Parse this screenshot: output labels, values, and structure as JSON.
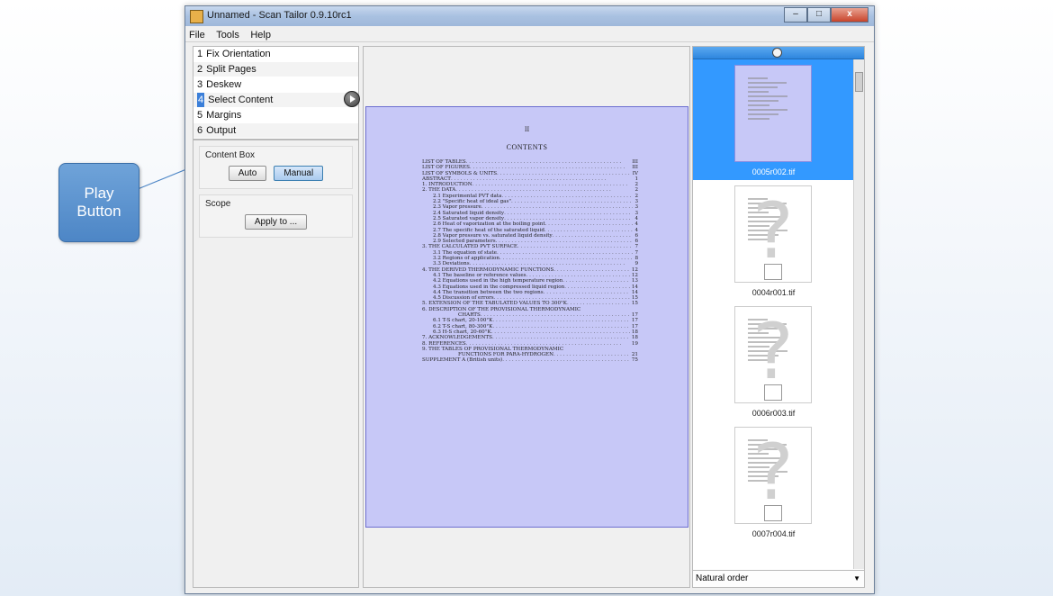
{
  "window": {
    "title": "Unnamed - Scan Tailor 0.9.10rc1",
    "controls": {
      "minimize": "–",
      "maximize": "□",
      "close": "x"
    }
  },
  "menu": [
    "File",
    "Tools",
    "Help"
  ],
  "stages": [
    {
      "num": "1",
      "label": "Fix Orientation"
    },
    {
      "num": "2",
      "label": "Split Pages"
    },
    {
      "num": "3",
      "label": "Deskew"
    },
    {
      "num": "4",
      "label": "Select Content",
      "selected": true
    },
    {
      "num": "5",
      "label": "Margins"
    },
    {
      "num": "6",
      "label": "Output"
    }
  ],
  "options": {
    "content_box": {
      "title": "Content Box",
      "auto": "Auto",
      "manual": "Manual",
      "active": "Manual"
    },
    "scope": {
      "title": "Scope",
      "apply": "Apply to ..."
    }
  },
  "page": {
    "number": "II",
    "heading": "CONTENTS",
    "toc": [
      {
        "t": "LIST OF TABLES",
        "p": "III"
      },
      {
        "t": "LIST OF FIGURES",
        "p": "III"
      },
      {
        "t": "LIST OF SYMBOLS & UNITS",
        "p": "IV"
      },
      {
        "t": "ABSTRACT",
        "p": "1"
      },
      {
        "t": "1. INTRODUCTION",
        "p": "2"
      },
      {
        "t": "2. THE DATA",
        "p": "2"
      },
      {
        "t": "2.1 Experimental PVT data",
        "p": "2",
        "ind": 1
      },
      {
        "t": "2.2 \"Specific heat of ideal gas\"",
        "p": "3",
        "ind": 1
      },
      {
        "t": "2.3 Vapor pressure",
        "p": "3",
        "ind": 1
      },
      {
        "t": "2.4 Saturated liquid density",
        "p": "3",
        "ind": 1
      },
      {
        "t": "2.5 Saturated vapor density",
        "p": "4",
        "ind": 1
      },
      {
        "t": "2.6 Heat of vaporization at the boiling point",
        "p": "4",
        "ind": 1
      },
      {
        "t": "2.7 The specific heat of the saturated liquid",
        "p": "4",
        "ind": 1
      },
      {
        "t": "2.8 Vapor pressure vs. saturated liquid density",
        "p": "6",
        "ind": 1
      },
      {
        "t": "2.9 Selected parameters",
        "p": "6",
        "ind": 1
      },
      {
        "t": "3. THE CALCULATED PVT SURFACE",
        "p": "7"
      },
      {
        "t": "3.1 The equation of state",
        "p": "7",
        "ind": 1
      },
      {
        "t": "3.2 Regions of application",
        "p": "8",
        "ind": 1
      },
      {
        "t": "3.3 Deviations",
        "p": "9",
        "ind": 1
      },
      {
        "t": "4. THE DERIVED THERMODYNAMIC FUNCTIONS",
        "p": "12"
      },
      {
        "t": "4.1 The baseline or reference values",
        "p": "12",
        "ind": 1
      },
      {
        "t": "4.2 Equations used in the high temperature region",
        "p": "13",
        "ind": 1
      },
      {
        "t": "4.3 Equations used in the compressed liquid region",
        "p": "14",
        "ind": 1
      },
      {
        "t": "4.4 The transition between the two regions",
        "p": "14",
        "ind": 1
      },
      {
        "t": "4.5 Discussion of errors",
        "p": "15",
        "ind": 1
      },
      {
        "t": "5. EXTENSION OF THE TABULATED VALUES TO 300°K",
        "p": "15"
      },
      {
        "t": "6. DESCRIPTION OF THE PROVISIONAL THERMODYNAMIC",
        "p": ""
      },
      {
        "t": "CHARTS",
        "p": "17",
        "ind": 2
      },
      {
        "t": "6.1 T-S chart, 20-100°K",
        "p": "17",
        "ind": 1
      },
      {
        "t": "6.2 T-S chart, 80-300°K",
        "p": "17",
        "ind": 1
      },
      {
        "t": "6.3 H-S chart, 20-60°K",
        "p": "18",
        "ind": 1
      },
      {
        "t": "7. ACKNOWLEDGEMENTS",
        "p": "18"
      },
      {
        "t": "8. REFERENCES",
        "p": "19"
      },
      {
        "t": "9. THE TABLES OF PROVISIONAL THERMODYNAMIC",
        "p": ""
      },
      {
        "t": "FUNCTIONS FOR PARA-HYDROGEN",
        "p": "21",
        "ind": 2
      },
      {
        "t": "SUPPLEMENT A (British units)",
        "p": "75"
      }
    ]
  },
  "thumbnails": [
    {
      "label": "0005r002.tif",
      "selected": true
    },
    {
      "label": "0004r001.tif"
    },
    {
      "label": "0006r003.tif"
    },
    {
      "label": "0007r004.tif"
    }
  ],
  "sort_order": "Natural order",
  "callout": {
    "line1": "Play",
    "line2": "Button"
  },
  "colors": {
    "selection": "#3399ff",
    "content_box": "#c7c8f7",
    "callout": "#5b91cd"
  }
}
